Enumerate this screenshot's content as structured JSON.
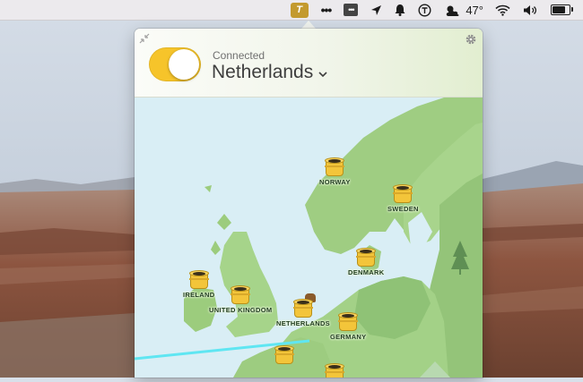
{
  "menubar": {
    "app_icon_letter": "T",
    "more_dots": "•••",
    "box_dots": "•••",
    "weather_temp": "47°",
    "icons": [
      "tunnelbear-icon",
      "more-icon",
      "extras-icon",
      "location-arrow-icon",
      "bell-icon",
      "clock-icon",
      "weather-icon",
      "wifi-icon",
      "volume-icon",
      "battery-icon"
    ]
  },
  "vpn": {
    "status": "Connected",
    "country": "Netherlands",
    "toggle_on": true,
    "accent": "#f6c42a"
  },
  "map": {
    "locations": [
      {
        "label": "NORWAY"
      },
      {
        "label": "SWEDEN"
      },
      {
        "label": "DENMARK"
      },
      {
        "label": "IRELAND"
      },
      {
        "label": "UNITED KINGDOM"
      },
      {
        "label": "NETHERLANDS"
      },
      {
        "label": "GERMANY"
      }
    ],
    "land_color": "#9ccc7d",
    "sea_color": "#d9eef5"
  }
}
